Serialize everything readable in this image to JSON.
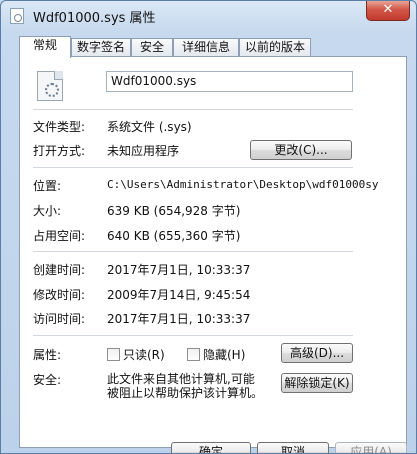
{
  "window": {
    "title": "Wdf01000.sys 属性",
    "close_label": "✕"
  },
  "tabs": [
    {
      "label": "常规",
      "active": true
    },
    {
      "label": "数字签名",
      "active": false
    },
    {
      "label": "安全",
      "active": false
    },
    {
      "label": "详细信息",
      "active": false
    },
    {
      "label": "以前的版本",
      "active": false
    }
  ],
  "general": {
    "file_name": "Wdf01000.sys",
    "file_type_label": "文件类型:",
    "file_type_value": "系统文件 (.sys)",
    "open_with_label": "打开方式:",
    "open_with_value": "未知应用程序",
    "change_button": "更改(C)...",
    "location_label": "位置:",
    "location_value": "C:\\Users\\Administrator\\Desktop\\wdf01000sy",
    "size_label": "大小:",
    "size_value": "639 KB (654,928 字节)",
    "size_on_disk_label": "占用空间:",
    "size_on_disk_value": "640 KB (655,360 字节)",
    "created_label": "创建时间:",
    "created_value": "2017年7月1日, 10:33:37",
    "modified_label": "修改时间:",
    "modified_value": "2009年7月14日, 9:45:54",
    "accessed_label": "访问时间:",
    "accessed_value": "2017年7月1日, 10:33:37",
    "attributes_label": "属性:",
    "readonly_label": "只读(R)",
    "hidden_label": "隐藏(H)",
    "advanced_button": "高级(D)...",
    "security_label": "安全:",
    "security_text_line1": "此文件来自其他计算机,可能",
    "security_text_line2": "被阻止以帮助保护该计算机。",
    "unblock_button": "解除锁定(K)"
  },
  "footer": {
    "ok_button": "确定",
    "cancel_button": "取消",
    "apply_button": "应用(A)"
  }
}
